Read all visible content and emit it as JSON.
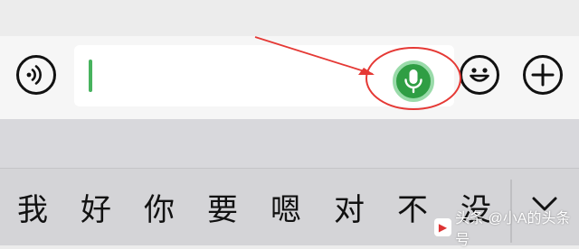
{
  "keyboard": {
    "candidates": [
      "我",
      "好",
      "你",
      "要",
      "嗯",
      "对",
      "不",
      "没"
    ]
  },
  "icons": {
    "voice_toggle": "voice-toggle-icon",
    "microphone": "microphone-icon",
    "emoji": "smiley-icon",
    "plus": "plus-icon",
    "expand": "chevron-down-icon"
  },
  "colors": {
    "mic_fill": "#2f9e44",
    "mic_ring": "#9adbaa",
    "caret": "#47b35e",
    "annotation": "#e53935"
  },
  "watermark": {
    "text": "头条 @小A的头条号"
  }
}
